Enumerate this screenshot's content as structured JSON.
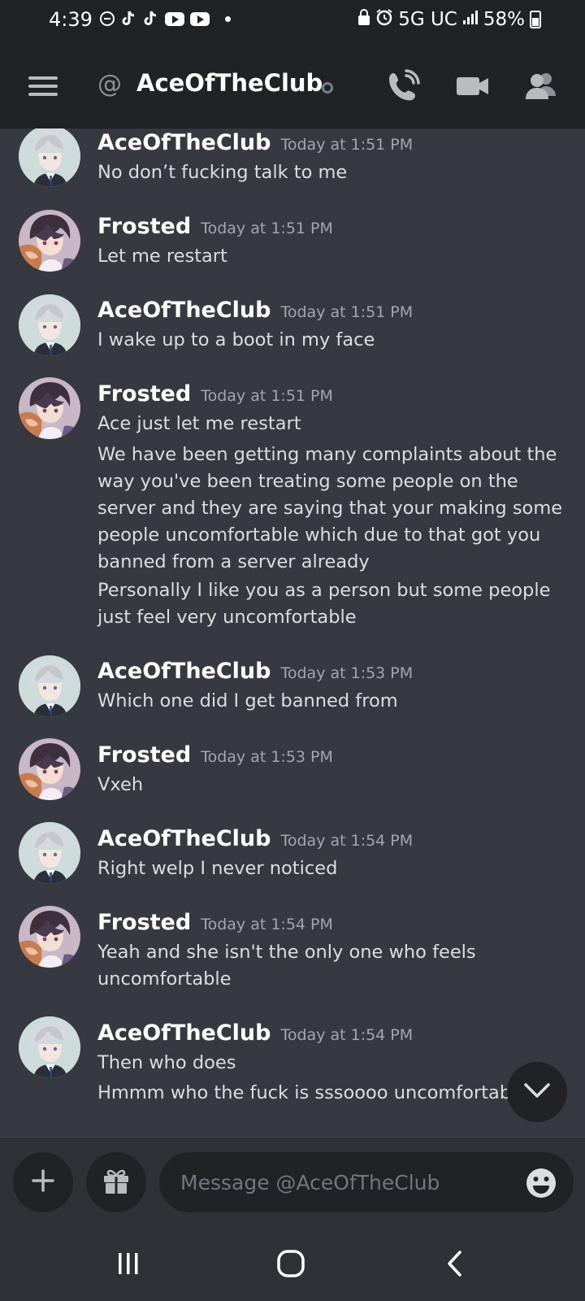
{
  "status_bar": {
    "time": "4:39",
    "network": "5G UC",
    "battery": "58%",
    "notification_icons": [
      "vpn-lock-icon",
      "tiktok-icon",
      "tiktok-icon",
      "youtube-icon",
      "youtube-icon",
      "more-dot-icon"
    ],
    "system_icons": [
      "lock-icon",
      "alarm-icon",
      "signal-icon",
      "battery-icon"
    ]
  },
  "header": {
    "at_symbol": "@",
    "title": "AceOfTheClub",
    "icons": [
      "menu-icon",
      "call-icon",
      "video-call-icon",
      "members-icon"
    ]
  },
  "messages": [
    {
      "author": "AceOfTheClub",
      "avatar": "ace",
      "timestamp": "Today at 1:51 PM",
      "lines": [
        "No don’t fucking talk to me"
      ]
    },
    {
      "author": "Frosted",
      "avatar": "frosted",
      "timestamp": "Today at 1:51 PM",
      "lines": [
        "Let me restart"
      ]
    },
    {
      "author": "AceOfTheClub",
      "avatar": "ace",
      "timestamp": "Today at 1:51 PM",
      "lines": [
        "I wake up to a boot in my face"
      ]
    },
    {
      "author": "Frosted",
      "avatar": "frosted",
      "timestamp": "Today at 1:51 PM",
      "lines": [
        "Ace just let me restart",
        "We have been getting many complaints about the way you've been treating some people on the server and they are saying that your making some people uncomfortable which due to that got you banned from a server already",
        "Personally I like you as a person but some people just feel very uncomfortable"
      ]
    },
    {
      "author": "AceOfTheClub",
      "avatar": "ace",
      "timestamp": "Today at 1:53 PM",
      "lines": [
        "Which one did I get banned from"
      ]
    },
    {
      "author": "Frosted",
      "avatar": "frosted",
      "timestamp": "Today at 1:53 PM",
      "lines": [
        "Vxeh"
      ]
    },
    {
      "author": "AceOfTheClub",
      "avatar": "ace",
      "timestamp": "Today at 1:54 PM",
      "lines": [
        "Right welp I never noticed"
      ]
    },
    {
      "author": "Frosted",
      "avatar": "frosted",
      "timestamp": "Today at 1:54 PM",
      "lines": [
        "Yeah and she isn't the only one who feels uncomfortable"
      ]
    },
    {
      "author": "AceOfTheClub",
      "avatar": "ace",
      "timestamp": "Today at 1:54 PM",
      "lines": [
        "Then who does",
        "Hmmm who the fuck is sssoooo uncomfortable"
      ]
    }
  ],
  "composer": {
    "placeholder": "Message @AceOfTheClub",
    "icons": [
      "plus-icon",
      "gift-icon",
      "emoji-icon"
    ]
  },
  "scroll_button_icon": "chevron-down-icon",
  "nav_icons": [
    "recents-icon",
    "home-icon",
    "back-icon"
  ],
  "colors": {
    "background": "#36393f",
    "header": "#202225",
    "composer": "#2f3136",
    "username": "#ffffff",
    "timestamp": "#a3a6aa",
    "text": "#dcddde"
  }
}
